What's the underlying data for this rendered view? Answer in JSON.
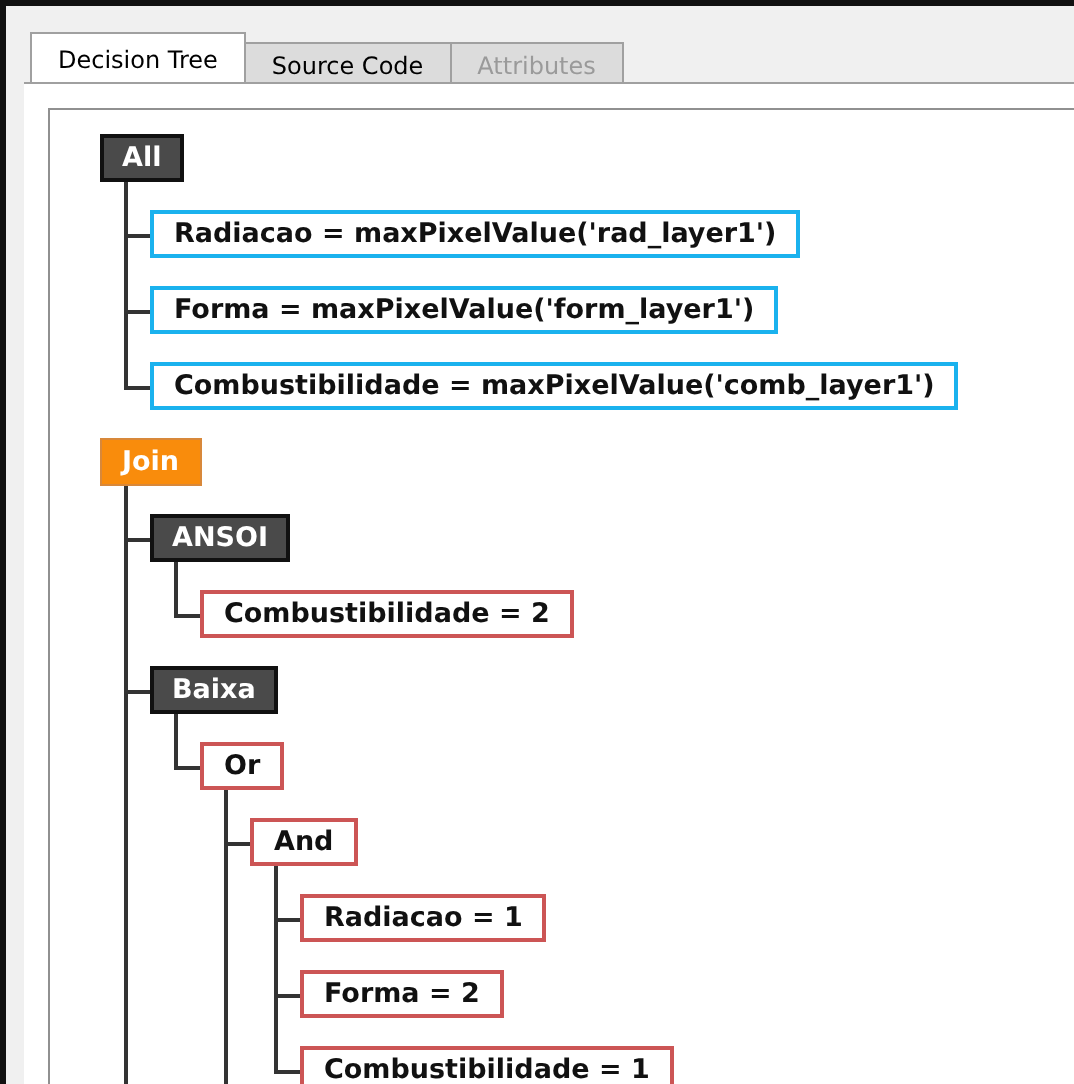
{
  "tabs": [
    {
      "label": "Decision Tree",
      "selected": true,
      "disabled": false
    },
    {
      "label": "Source Code",
      "selected": false,
      "disabled": false
    },
    {
      "label": "Attributes",
      "selected": false,
      "disabled": true
    }
  ],
  "tree": [
    {
      "label": "All",
      "kind": "group",
      "children": [
        {
          "label": "Radiacao = maxPixelValue('rad_layer1')",
          "kind": "assign"
        },
        {
          "label": "Forma = maxPixelValue('form_layer1')",
          "kind": "assign"
        },
        {
          "label": "Combustibilidade = maxPixelValue('comb_layer1')",
          "kind": "assign"
        }
      ]
    },
    {
      "label": "Join",
      "kind": "join",
      "continues": true,
      "children": [
        {
          "label": "ANSOI",
          "kind": "group",
          "children": [
            {
              "label": "Combustibilidade = 2",
              "kind": "condition"
            }
          ]
        },
        {
          "label": "Baixa",
          "kind": "group",
          "children": [
            {
              "label": "Or",
              "kind": "condition",
              "continues": true,
              "children": [
                {
                  "label": "And",
                  "kind": "condition",
                  "children": [
                    {
                      "label": "Radiacao = 1",
                      "kind": "condition"
                    },
                    {
                      "label": "Forma = 2",
                      "kind": "condition"
                    },
                    {
                      "label": "Combustibilidade = 1",
                      "kind": "condition"
                    }
                  ]
                }
              ]
            }
          ]
        }
      ]
    }
  ]
}
